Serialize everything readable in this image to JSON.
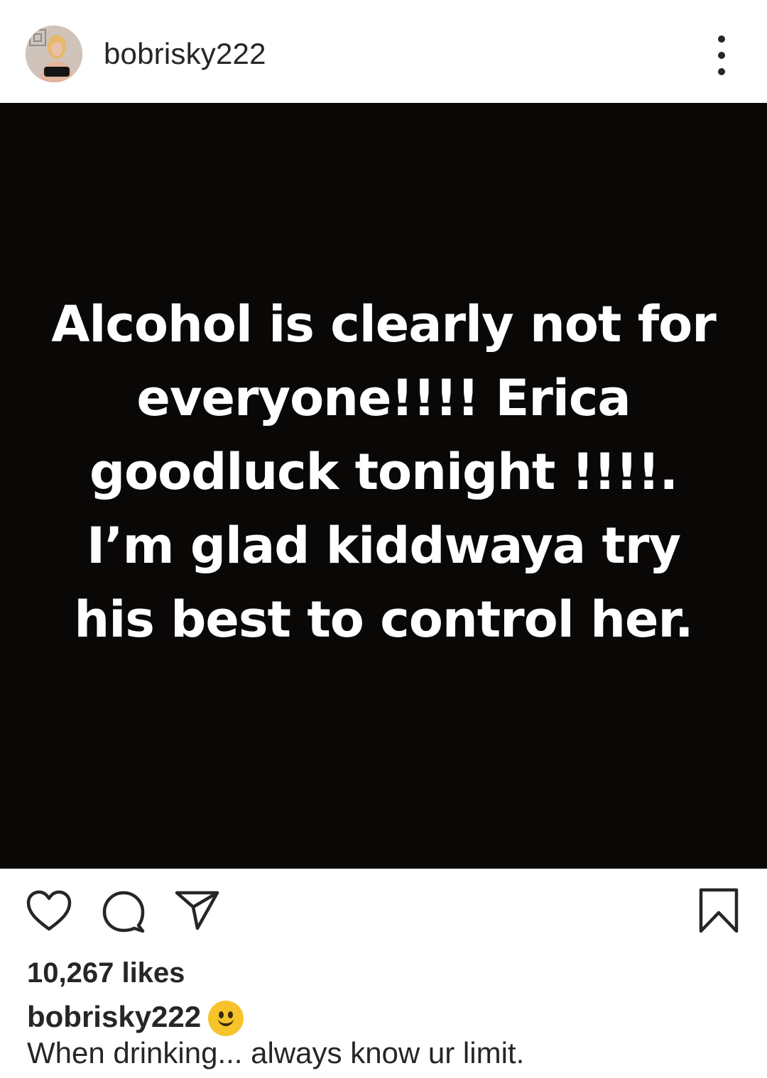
{
  "header": {
    "username": "bobrisky222",
    "avatar_icon": "profile-avatar",
    "more_icon": "more-options-icon"
  },
  "post": {
    "image_text": "Alcohol is clearly not for everyone!!!! Erica goodluck tonight !!!!. I’m glad kiddwaya try his best to control her.",
    "background_color": "#0a0707",
    "text_color": "#ffffff"
  },
  "actions": {
    "like_icon": "heart-icon",
    "comment_icon": "comment-icon",
    "share_icon": "share-icon",
    "save_icon": "bookmark-icon"
  },
  "likes": "10,267 likes",
  "caption": {
    "username": "bobrisky222",
    "emoji": "smiling-face-icon",
    "text": "When drinking... always know ur limit."
  }
}
